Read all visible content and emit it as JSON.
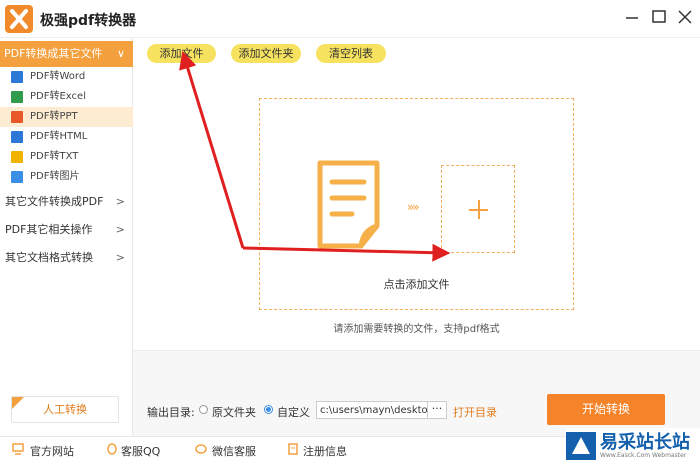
{
  "window": {
    "title": "极强pdf转换器"
  },
  "sidebar": {
    "group_head": "PDF转换成其它文件",
    "group_chev": "∨",
    "sub_items": [
      {
        "label": "PDF转Word",
        "color": "#2b78d6",
        "active": false
      },
      {
        "label": "PDF转Excel",
        "color": "#2e9b4d",
        "active": false
      },
      {
        "label": "PDF转PPT",
        "color": "#e8582b",
        "active": true
      },
      {
        "label": "PDF转HTML",
        "color": "#2b78d6",
        "active": false
      },
      {
        "label": "PDF转TXT",
        "color": "#f0b400",
        "active": false
      },
      {
        "label": "PDF转图片",
        "color": "#3a8ee6",
        "active": false
      }
    ],
    "categories": [
      {
        "label": "其它文件转换成PDF",
        "chev": ">"
      },
      {
        "label": "PDF其它相关操作",
        "chev": ">"
      },
      {
        "label": "其它文档格式转换",
        "chev": ">"
      }
    ],
    "human_button": "人工转换"
  },
  "toolbar": {
    "add_file": "添加文件",
    "add_folder": "添加文件夹",
    "clear_list": "清空列表"
  },
  "dropzone": {
    "arrows": "»»",
    "click_add": "点击添加文件",
    "hint": "请添加需要转换的文件，支持pdf格式"
  },
  "output": {
    "label": "输出目录:",
    "option_source": "原文件夹",
    "option_custom": "自定义",
    "path_value": "c:\\users\\mayn\\desktop",
    "browse": "···",
    "open_dir": "打开目录",
    "start": "开始转换"
  },
  "bottom": {
    "website": "官方网站",
    "qq": "客服QQ",
    "wechat": "微信客服",
    "register": "注册信息"
  },
  "watermark": {
    "title": "易采站长站",
    "subtitle": "Www.Easck.Com Webmaster"
  },
  "colors": {
    "accent": "#f5a03f",
    "start_button": "#f5832a",
    "pill": "#f6e25f",
    "annotation": "#e02020"
  }
}
